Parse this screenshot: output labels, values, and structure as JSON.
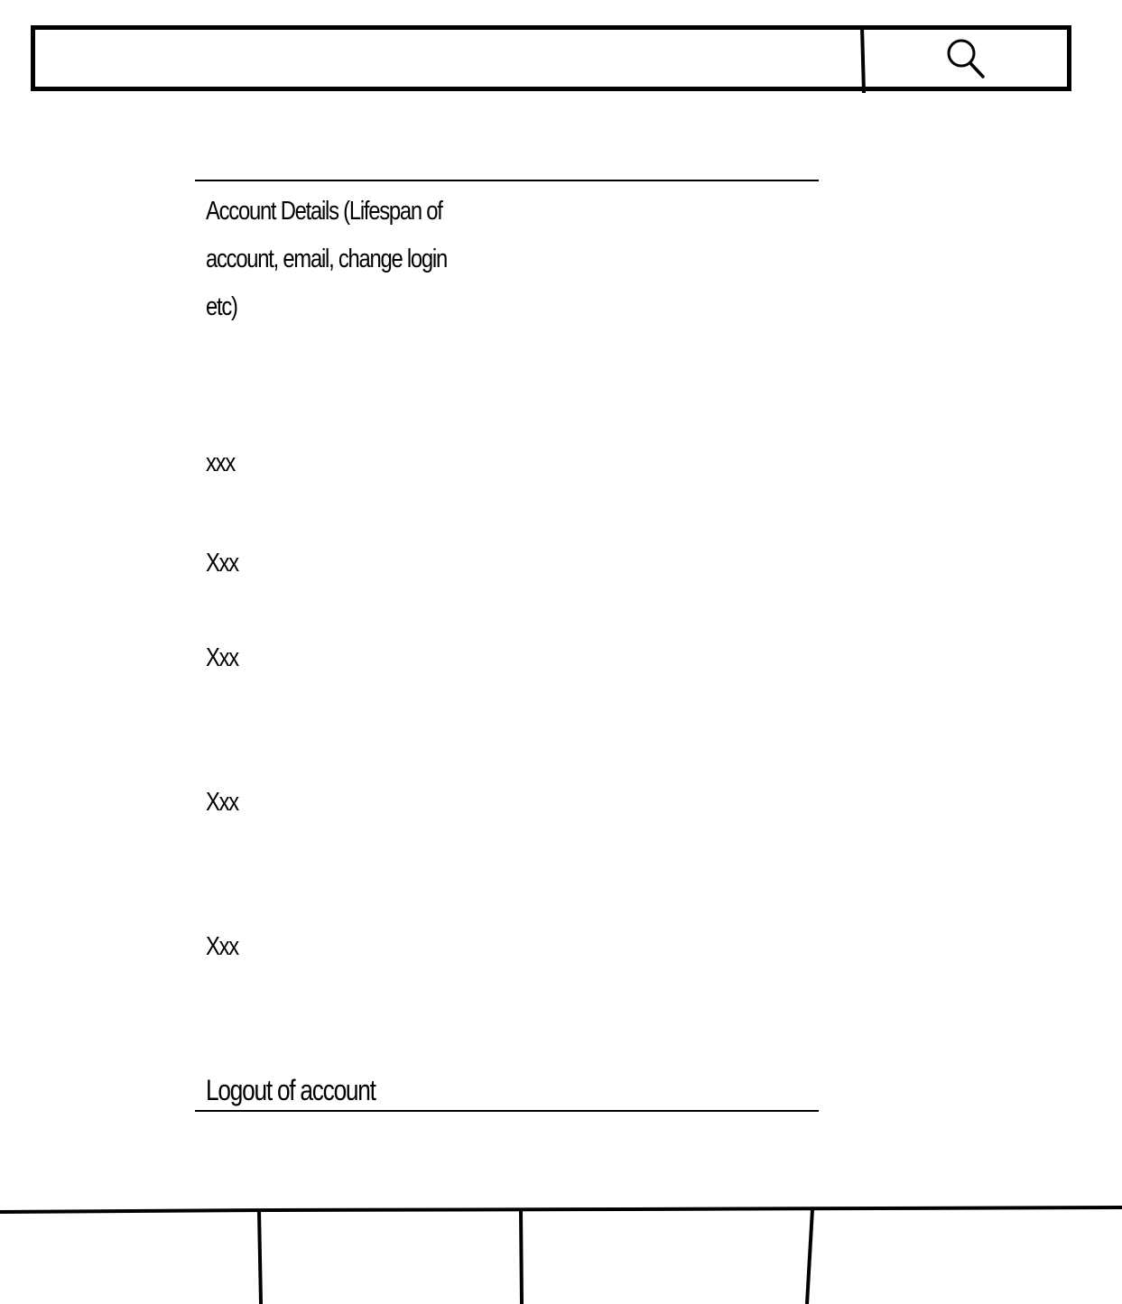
{
  "search": {
    "value": "",
    "placeholder": "",
    "icon": "search-icon"
  },
  "account": {
    "details_title": "Account Details (Lifespan of account, email, change login etc)",
    "items": [
      "xxx",
      "Xxx",
      "Xxx",
      "Xxx",
      "Xxx"
    ],
    "logout_label": "Logout of account"
  },
  "bottom_nav": {
    "tabs": [
      "",
      "",
      "",
      ""
    ]
  },
  "colors": {
    "background": "#ffffff",
    "ink": "#000000"
  }
}
